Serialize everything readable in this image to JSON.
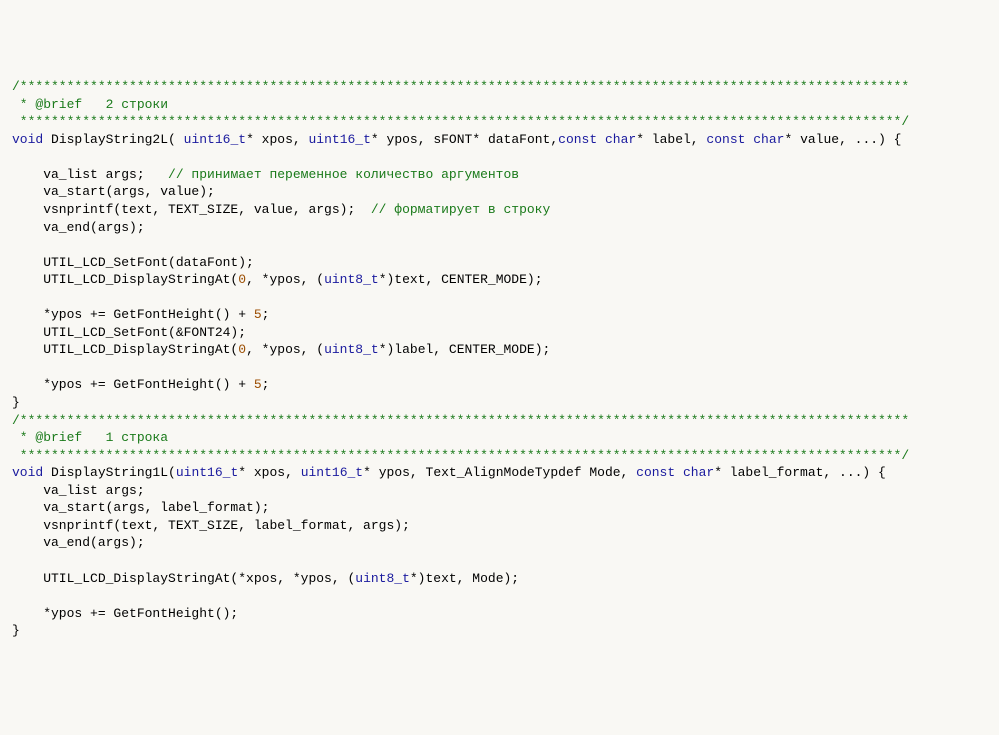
{
  "lines": [
    {
      "segments": [
        {
          "cls": "cmnt",
          "text": "/******************************************************************************************************************"
        }
      ]
    },
    {
      "segments": [
        {
          "cls": "cmnt",
          "text": " * @brief   2 строки"
        }
      ]
    },
    {
      "segments": [
        {
          "cls": "cmnt",
          "text": " *****************************************************************************************************************/"
        }
      ]
    },
    {
      "segments": [
        {
          "cls": "kw",
          "text": "void"
        },
        {
          "cls": "id",
          "text": " DisplayString2L( "
        },
        {
          "cls": "type",
          "text": "uint16_t"
        },
        {
          "cls": "id",
          "text": "* xpos, "
        },
        {
          "cls": "type",
          "text": "uint16_t"
        },
        {
          "cls": "id",
          "text": "* ypos, sFONT* dataFont,"
        },
        {
          "cls": "kw",
          "text": "const"
        },
        {
          "cls": "id",
          "text": " "
        },
        {
          "cls": "kw",
          "text": "char"
        },
        {
          "cls": "id",
          "text": "* label, "
        },
        {
          "cls": "kw",
          "text": "const"
        },
        {
          "cls": "id",
          "text": " "
        },
        {
          "cls": "kw",
          "text": "char"
        },
        {
          "cls": "id",
          "text": "* value, ...) {"
        }
      ]
    },
    {
      "segments": [
        {
          "cls": "id",
          "text": ""
        }
      ]
    },
    {
      "segments": [
        {
          "cls": "id",
          "text": "    va_list args;   "
        },
        {
          "cls": "cmnt",
          "text": "// принимает переменное количество аргументов"
        }
      ]
    },
    {
      "segments": [
        {
          "cls": "id",
          "text": "    va_start(args, value);"
        }
      ]
    },
    {
      "segments": [
        {
          "cls": "id",
          "text": "    vsnprintf(text, TEXT_SIZE, value, args);  "
        },
        {
          "cls": "cmnt",
          "text": "// форматирует в строку"
        }
      ]
    },
    {
      "segments": [
        {
          "cls": "id",
          "text": "    va_end(args);"
        }
      ]
    },
    {
      "segments": [
        {
          "cls": "id",
          "text": ""
        }
      ]
    },
    {
      "segments": [
        {
          "cls": "id",
          "text": "    UTIL_LCD_SetFont(dataFont);"
        }
      ]
    },
    {
      "segments": [
        {
          "cls": "id",
          "text": "    UTIL_LCD_DisplayStringAt("
        },
        {
          "cls": "num",
          "text": "0"
        },
        {
          "cls": "id",
          "text": ", *ypos, ("
        },
        {
          "cls": "type",
          "text": "uint8_t"
        },
        {
          "cls": "id",
          "text": "*)text, CENTER_MODE);"
        }
      ]
    },
    {
      "segments": [
        {
          "cls": "id",
          "text": ""
        }
      ]
    },
    {
      "segments": [
        {
          "cls": "id",
          "text": "    *ypos += GetFontHeight() + "
        },
        {
          "cls": "num",
          "text": "5"
        },
        {
          "cls": "id",
          "text": ";"
        }
      ]
    },
    {
      "segments": [
        {
          "cls": "id",
          "text": "    UTIL_LCD_SetFont(&FONT24);"
        }
      ]
    },
    {
      "segments": [
        {
          "cls": "id",
          "text": "    UTIL_LCD_DisplayStringAt("
        },
        {
          "cls": "num",
          "text": "0"
        },
        {
          "cls": "id",
          "text": ", *ypos, ("
        },
        {
          "cls": "type",
          "text": "uint8_t"
        },
        {
          "cls": "id",
          "text": "*)label, CENTER_MODE);"
        }
      ]
    },
    {
      "segments": [
        {
          "cls": "id",
          "text": ""
        }
      ]
    },
    {
      "segments": [
        {
          "cls": "id",
          "text": "    *ypos += GetFontHeight() + "
        },
        {
          "cls": "num",
          "text": "5"
        },
        {
          "cls": "id",
          "text": ";"
        }
      ]
    },
    {
      "segments": [
        {
          "cls": "id",
          "text": "}"
        }
      ]
    },
    {
      "segments": [
        {
          "cls": "cmnt",
          "text": "/******************************************************************************************************************"
        }
      ]
    },
    {
      "segments": [
        {
          "cls": "cmnt",
          "text": " * @brief   1 строка"
        }
      ]
    },
    {
      "segments": [
        {
          "cls": "cmnt",
          "text": " *****************************************************************************************************************/"
        }
      ]
    },
    {
      "segments": [
        {
          "cls": "kw",
          "text": "void"
        },
        {
          "cls": "id",
          "text": " DisplayString1L("
        },
        {
          "cls": "type",
          "text": "uint16_t"
        },
        {
          "cls": "id",
          "text": "* xpos, "
        },
        {
          "cls": "type",
          "text": "uint16_t"
        },
        {
          "cls": "id",
          "text": "* ypos, Text_AlignModeTypdef Mode, "
        },
        {
          "cls": "kw",
          "text": "const"
        },
        {
          "cls": "id",
          "text": " "
        },
        {
          "cls": "kw",
          "text": "char"
        },
        {
          "cls": "id",
          "text": "* label_format, ...) {"
        }
      ]
    },
    {
      "segments": [
        {
          "cls": "id",
          "text": "    va_list args;"
        }
      ]
    },
    {
      "segments": [
        {
          "cls": "id",
          "text": "    va_start(args, label_format);"
        }
      ]
    },
    {
      "segments": [
        {
          "cls": "id",
          "text": "    vsnprintf(text, TEXT_SIZE, label_format, args);"
        }
      ]
    },
    {
      "segments": [
        {
          "cls": "id",
          "text": "    va_end(args);"
        }
      ]
    },
    {
      "segments": [
        {
          "cls": "id",
          "text": ""
        }
      ]
    },
    {
      "segments": [
        {
          "cls": "id",
          "text": "    UTIL_LCD_DisplayStringAt(*xpos, *ypos, ("
        },
        {
          "cls": "type",
          "text": "uint8_t"
        },
        {
          "cls": "id",
          "text": "*)text, Mode);"
        }
      ]
    },
    {
      "segments": [
        {
          "cls": "id",
          "text": ""
        }
      ]
    },
    {
      "segments": [
        {
          "cls": "id",
          "text": "    *ypos += GetFontHeight();"
        }
      ]
    },
    {
      "segments": [
        {
          "cls": "id",
          "text": "}"
        }
      ]
    }
  ]
}
